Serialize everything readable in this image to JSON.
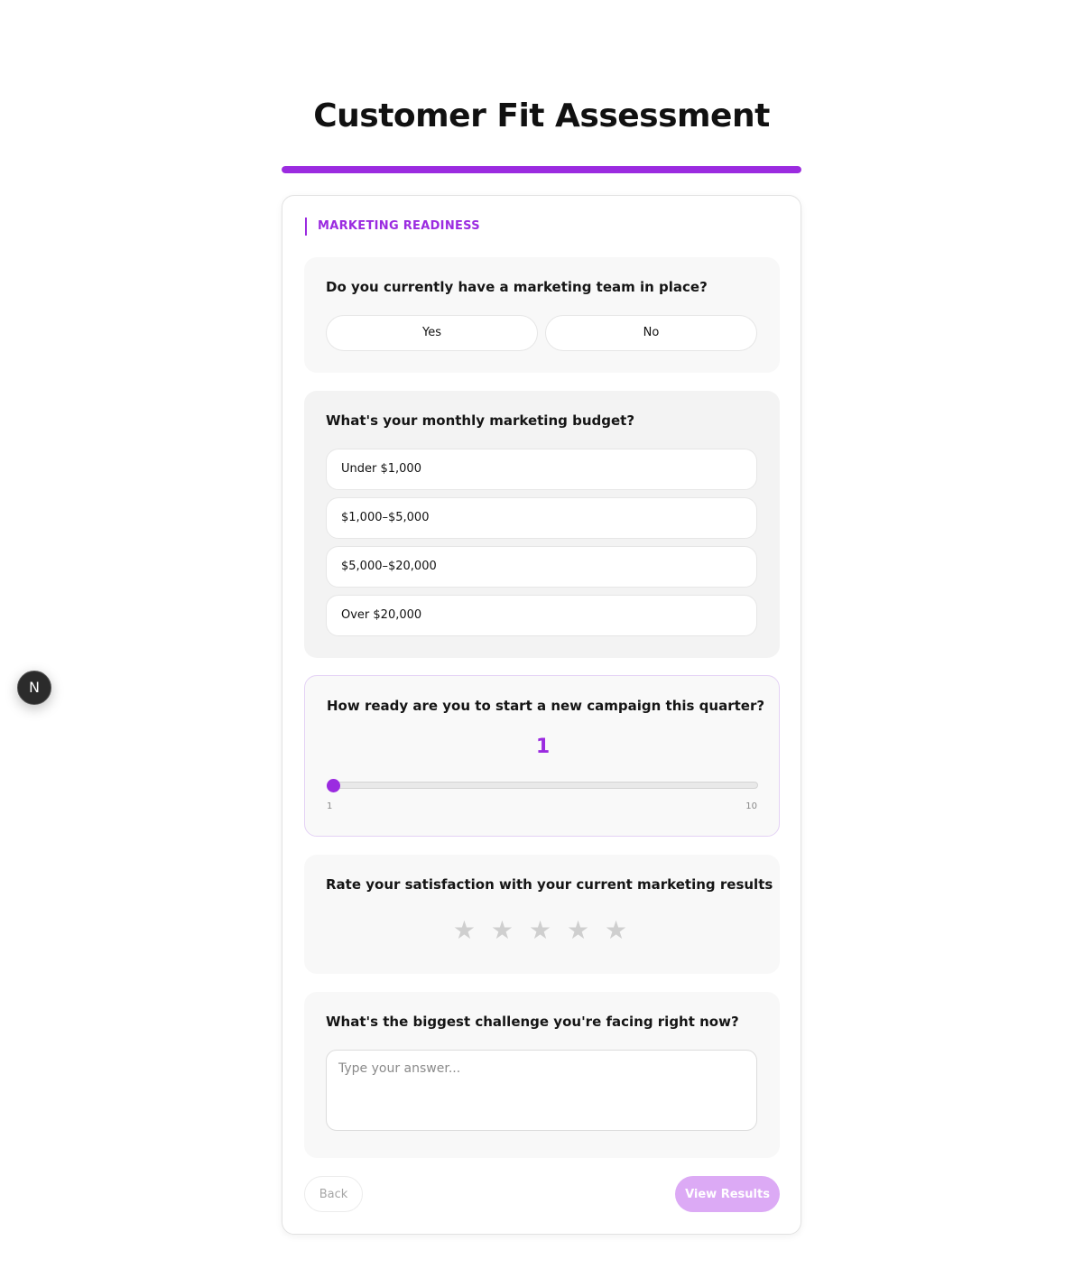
{
  "page": {
    "title": "Customer Fit Assessment",
    "progress_percent": 100,
    "accent_color": "#9b2be0"
  },
  "section": {
    "label": "MARKETING READINESS"
  },
  "q1": {
    "text": "Do you currently have a marketing team in place?",
    "options": [
      "Yes",
      "No"
    ]
  },
  "q2": {
    "text": "What's your monthly marketing budget?",
    "options": [
      "Under $1,000",
      "$1,000–$5,000",
      "$5,000–$20,000",
      "Over $20,000"
    ]
  },
  "q3": {
    "text": "How ready are you to start a new campaign this quarter?",
    "value": "1",
    "min": "1",
    "max": "10"
  },
  "q4": {
    "text": "Rate your satisfaction with your current marketing results",
    "stars": [
      "★",
      "★",
      "★",
      "★",
      "★"
    ],
    "rating": 0,
    "max_rating": 5
  },
  "q5": {
    "text": "What's the biggest challenge you're facing right now?",
    "placeholder": "Type your answer..."
  },
  "nav": {
    "back_label": "Back",
    "results_label": "View Results"
  },
  "dev_badge": {
    "label": "N"
  }
}
